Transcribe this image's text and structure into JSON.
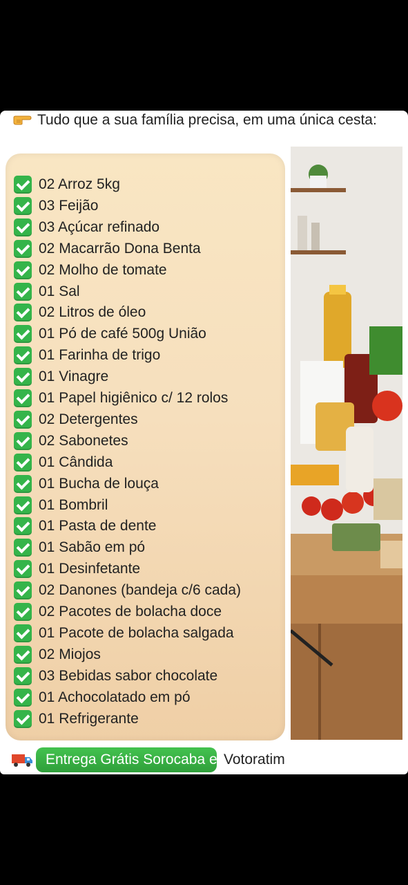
{
  "header": {
    "intro_text": "Tudo que a sua família precisa, em uma única cesta:",
    "pointing_icon": "backhand-index-pointing-right-icon"
  },
  "items": [
    "02 Arroz 5kg",
    "03 Feijão",
    "03 Açúcar refinado",
    "02 Macarrão Dona Benta",
    "02 Molho de tomate",
    "01 Sal",
    "02 Litros de óleo",
    "01 Pó de café 500g União",
    "01 Farinha de trigo",
    "01 Vinagre",
    "01 Papel higiênico c/ 12 rolos",
    "02 Detergentes",
    "02 Sabonetes",
    "01 Cândida",
    "01 Bucha de louça",
    "01 Bombril",
    "01 Pasta de dente",
    "01 Sabão em pó",
    "01 Desinfetante",
    "02 Danones (bandeja c/6 cada)",
    "02 Pacotes de bolacha doce",
    "01 Pacote de bolacha salgada",
    "02 Miojos",
    "03 Bebidas sabor chocolate",
    "01 Achocolatado em pó",
    "01 Refrigerante"
  ],
  "footer": {
    "truck_icon": "delivery-truck-icon",
    "badge_text": "Entrega Grátis Sorocaba e",
    "tail_text": "Votoratim"
  },
  "colors": {
    "check_green": "#35b44a",
    "badge_green": "#3bb446",
    "panel_bg": "#f7e1bf"
  }
}
